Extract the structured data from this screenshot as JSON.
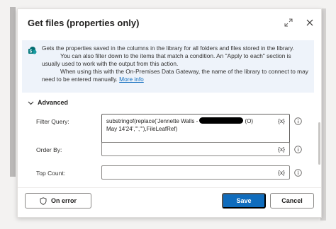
{
  "dialog": {
    "title": "Get files (properties only)",
    "info_line1": "Gets the properties saved in the columns in the library for all folders and files stored in the library.",
    "info_line2": "You can also filter down to the items that match a condition. An \"Apply to each\" section is usually used to work with the output from this action.",
    "info_line3": "When using this with the On-Premises Data Gateway, the name of the library to connect to may need to be entered manually.",
    "more_info": "More info"
  },
  "advanced": {
    "label": "Advanced"
  },
  "fields": {
    "filter_query": {
      "label": "Filter Query:",
      "value_part1": "substringof(replace('Jennette Walls -",
      "value_part2": "(O)",
      "value_line2": "May 14'24',''','''),FileLeafRef)",
      "fx": "{x}"
    },
    "order_by": {
      "label": "Order By:",
      "value": "",
      "fx": "{x}"
    },
    "top_count": {
      "label": "Top Count:",
      "value": "",
      "fx": "{x}"
    }
  },
  "footer": {
    "on_error": "On error",
    "save": "Save",
    "cancel": "Cancel"
  },
  "colors": {
    "accent": "#0f6cbd",
    "info_bg": "#eef3fa"
  },
  "icons": [
    "expand-icon",
    "close-icon",
    "info-icon",
    "chevron-down-icon",
    "help-icon",
    "shield-icon"
  ]
}
